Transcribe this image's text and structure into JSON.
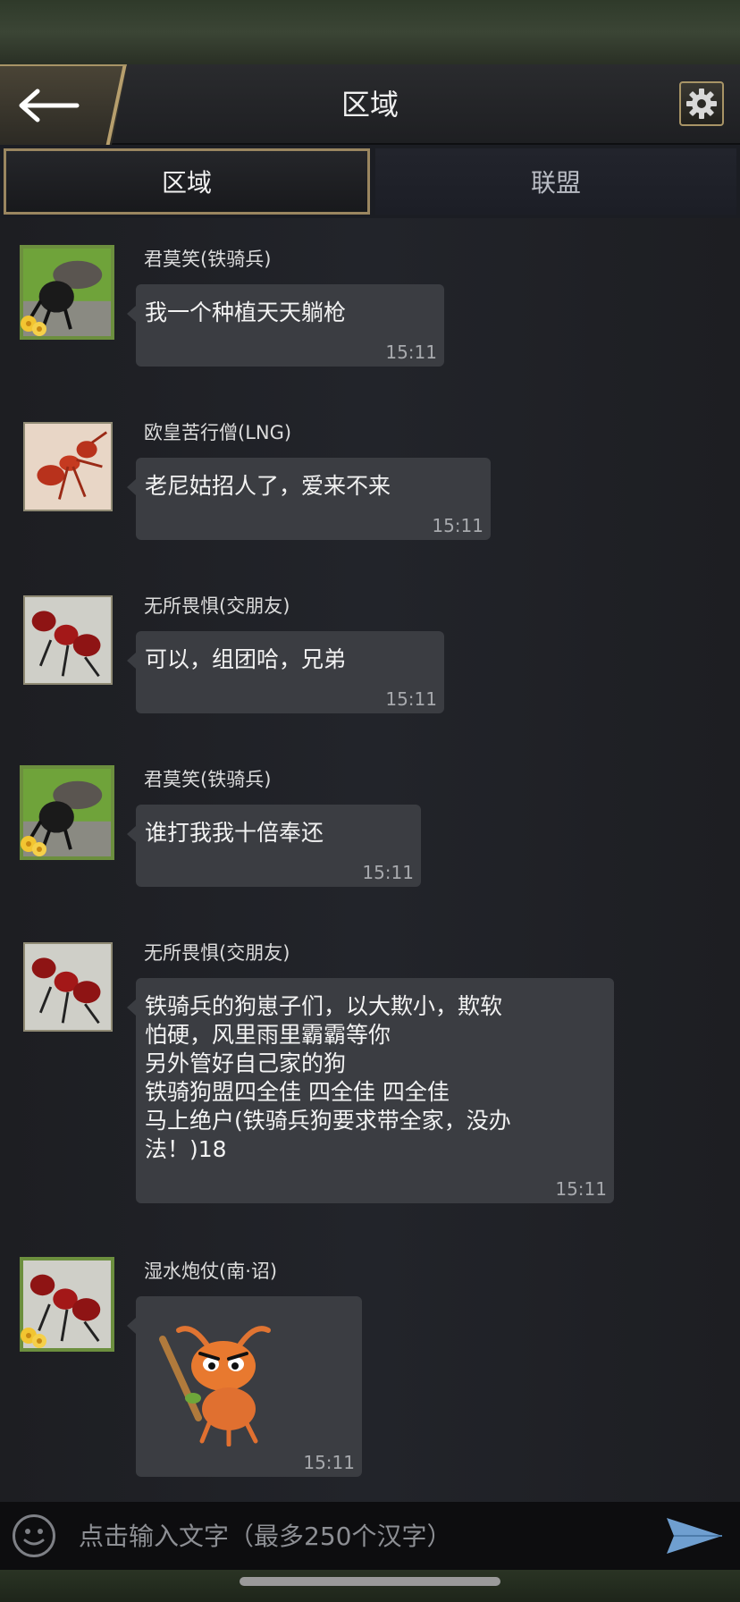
{
  "header": {
    "title": "区域"
  },
  "tabs": [
    {
      "label": "区域",
      "active": true
    },
    {
      "label": "联盟",
      "active": false
    }
  ],
  "messages": [
    {
      "sender": "君莫笑(铁骑兵)",
      "text": "我一个种植天天躺枪",
      "time": "15:11",
      "avatar": "stag-beetle-avatar"
    },
    {
      "sender": "欧皇苦行僧(LNG)",
      "text": "老尼姑招人了，爱来不来",
      "time": "15:11",
      "avatar": "red-ant-avatar"
    },
    {
      "sender": "无所畏惧(交朋友)",
      "text": "可以，组团哈，兄弟",
      "time": "15:11",
      "avatar": "red-ant-avatar"
    },
    {
      "sender": "君莫笑(铁骑兵)",
      "text": "谁打我我十倍奉还",
      "time": "15:11",
      "avatar": "stag-beetle-avatar"
    },
    {
      "sender": "无所畏惧(交朋友)",
      "text": "铁骑兵的狗崽子们，以大欺小，欺软\n怕硬，风里雨里霸霸等你\n另外管好自己家的狗\n铁骑狗盟四全佳 四全佳 四全佳\n马上绝户(铁骑兵狗要求带全家，没办\n法！)18",
      "time": "15:11",
      "avatar": "red-ant-avatar"
    },
    {
      "sender": "湿水炮仗(南·诏)",
      "text": "",
      "time": "15:11",
      "avatar": "red-ant-avatar",
      "sticker": "angry-ant-sticker"
    }
  ],
  "input": {
    "placeholder": "点击输入文字（最多250个汉字）"
  },
  "colors": {
    "accent_gold": "#a89466",
    "bubble": "#3b3d42",
    "background": "#1d1e22"
  }
}
